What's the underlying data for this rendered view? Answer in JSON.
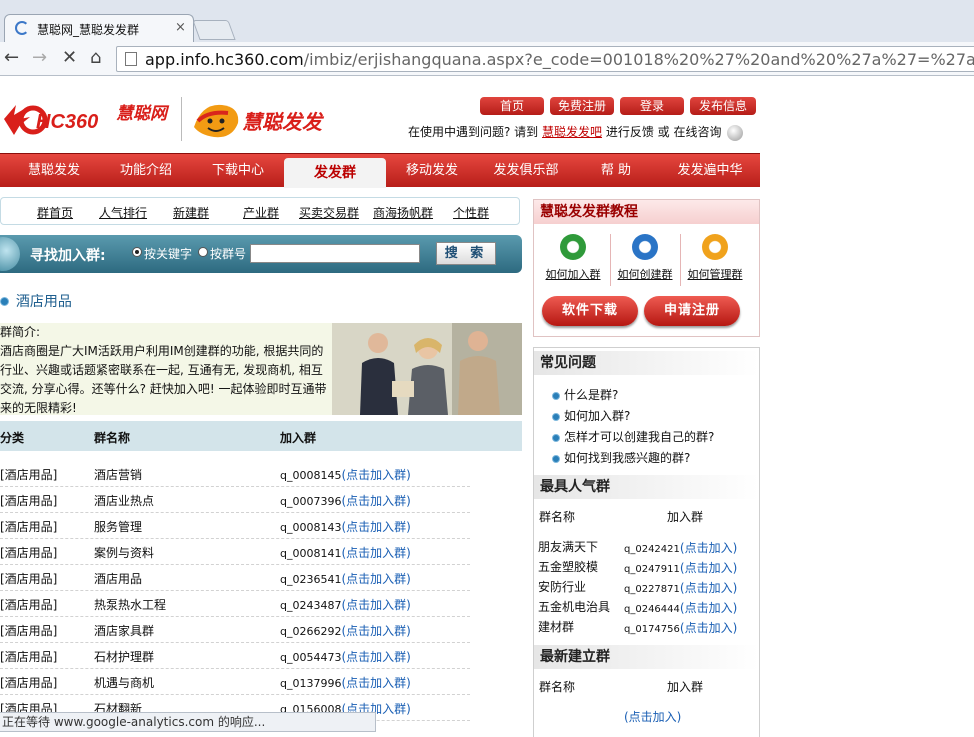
{
  "browser": {
    "tab_title": "慧聪网_慧聪发发群",
    "tab_close": "×",
    "url_host": "app.info.hc360.com",
    "url_path": "/imbiz/erjishangquana.aspx?e_code=001018%20%27%20and%20%27a%27=%27a",
    "status_text": "正在等待 www.google-analytics.com 的响应..."
  },
  "header": {
    "logo_hc": "HC360",
    "logo_hc_cn": "慧聪网",
    "logo_fafa": "慧聪发发",
    "top_links": [
      "首页",
      "免费注册",
      "登录",
      "发布信息"
    ],
    "help_prefix": "在使用中遇到问题? 请到",
    "help_link": "慧聪发发吧",
    "help_middle": "进行反馈 或",
    "help_suffix": "在线咨询"
  },
  "main_nav": [
    "慧聪发发",
    "功能介绍",
    "下载中心",
    "发发群",
    "移动发发",
    "发发俱乐部",
    "帮 助",
    "发发遍中华"
  ],
  "sub_nav": [
    "群首页",
    "人气排行",
    "新建群",
    "产业群",
    "买卖交易群",
    "商海扬帆群",
    "个性群"
  ],
  "search": {
    "title": "寻找加入群:",
    "option_keyword": "按关键字",
    "option_number": "按群号",
    "button": "搜 索",
    "value": ""
  },
  "category": {
    "title": "酒店用品",
    "intro_label": "群简介:",
    "intro_text": "酒店商圈是广大IM活跃用户利用IM创建群的功能, 根据共同的行业、兴趣或话题紧密联系在一起, 互通有无, 发现商机, 相互交流, 分享心得。还等什么? 赶快加入吧! 一起体验即时互通带来的无限精彩!"
  },
  "table": {
    "headers": [
      "分类",
      "群名称",
      "加入群"
    ],
    "join_text": "(点击加入群)",
    "rows": [
      {
        "cat": "[酒店用品]",
        "name": "酒店营销",
        "code": "q_0008145"
      },
      {
        "cat": "[酒店用品]",
        "name": "酒店业热点",
        "code": "q_0007396"
      },
      {
        "cat": "[酒店用品]",
        "name": "服务管理",
        "code": "q_0008143"
      },
      {
        "cat": "[酒店用品]",
        "name": "案例与资料",
        "code": "q_0008141"
      },
      {
        "cat": "[酒店用品]",
        "name": "酒店用品",
        "code": "q_0236541"
      },
      {
        "cat": "[酒店用品]",
        "name": "热泵热水工程",
        "code": "q_0243487"
      },
      {
        "cat": "[酒店用品]",
        "name": "酒店家具群",
        "code": "q_0266292"
      },
      {
        "cat": "[酒店用品]",
        "name": "石材护理群",
        "code": "q_0054473"
      },
      {
        "cat": "[酒店用品]",
        "name": "机遇与商机",
        "code": "q_0137996"
      },
      {
        "cat": "[酒店用品]",
        "name": "石材翻新",
        "code": "q_0156008"
      }
    ]
  },
  "sidebar": {
    "tutorial_title": "慧聪发发群教程",
    "tutorials": [
      "如何加入群",
      "如何创建群",
      "如何管理群"
    ],
    "download_btn": "软件下载",
    "register_btn": "申请注册",
    "faq_title": "常见问题",
    "faqs": [
      "什么是群?",
      "如何加入群?",
      "怎样才可以创建我自己的群?",
      "如何找到我感兴趣的群?"
    ],
    "popular_title": "最具人气群",
    "col_name": "群名称",
    "col_join": "加入群",
    "join_text": "(点击加入)",
    "popular": [
      {
        "name": "朋友满天下",
        "code": "q_0242421"
      },
      {
        "name": "五金塑胶模",
        "code": "q_0247911"
      },
      {
        "name": "安防行业",
        "code": "q_0227871"
      },
      {
        "name": "五金机电治具",
        "code": "q_0246444"
      },
      {
        "name": "建材群",
        "code": "q_0174756"
      }
    ],
    "newest_title": "最新建立群",
    "newest_join": "(点击加入)"
  },
  "colors": {
    "brand_red": "#c8231d",
    "link_blue": "#1a5fb4",
    "search_teal": "#2d6a80"
  },
  "icons": [
    "back-arrow-icon",
    "forward-arrow-icon",
    "stop-icon",
    "home-icon",
    "page-icon",
    "help-globe-icon"
  ]
}
